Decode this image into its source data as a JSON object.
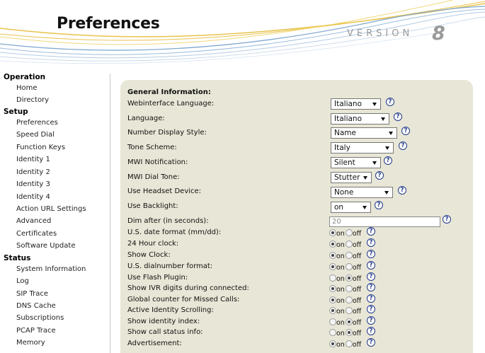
{
  "header": {
    "title": "Preferences",
    "version_word": "VERSION",
    "version_number": "8"
  },
  "sidebar": {
    "sections": [
      {
        "title": "Operation",
        "items": [
          "Home",
          "Directory"
        ]
      },
      {
        "title": "Setup",
        "items": [
          "Preferences",
          "Speed Dial",
          "Function Keys",
          "Identity 1",
          "Identity 2",
          "Identity 3",
          "Identity 4",
          "Action URL Settings",
          "Advanced",
          "Certificates",
          "Software Update"
        ]
      },
      {
        "title": "Status",
        "items": [
          "System Information",
          "Log",
          "SIP Trace",
          "DNS Cache",
          "Subscriptions",
          "PCAP Trace",
          "Memory"
        ]
      }
    ]
  },
  "form": {
    "section_title": "General Information:",
    "selects": [
      {
        "label": "Webinterface Language:",
        "value": "Italiano"
      },
      {
        "label": "Language:",
        "value": "Italiano"
      },
      {
        "label": "Number Display Style:",
        "value": "Name"
      },
      {
        "label": "Tone Scheme:",
        "value": "Italy"
      },
      {
        "label": "MWI Notification:",
        "value": "Silent"
      },
      {
        "label": "MWI Dial Tone:",
        "value": "Stutter"
      },
      {
        "label": "Use Headset Device:",
        "value": "None"
      },
      {
        "label": "Use Backlight:",
        "value": "on"
      }
    ],
    "dim": {
      "label": "Dim after (in seconds):",
      "value": "20"
    },
    "radio_on_label": "on",
    "radio_off_label": "off",
    "help_glyph": "?",
    "radios": [
      {
        "label": "U.S. date format (mm/dd):",
        "value": "on"
      },
      {
        "label": "24 Hour clock:",
        "value": "on"
      },
      {
        "label": "Show Clock:",
        "value": "on"
      },
      {
        "label": "U.S. dialnumber format:",
        "value": "on"
      },
      {
        "label": "Use Flash Plugin:",
        "value": "off"
      },
      {
        "label": "Show IVR digits during connected:",
        "value": "on"
      },
      {
        "label": "Global counter for Missed Calls:",
        "value": "on"
      },
      {
        "label": "Active Identity Scrolling:",
        "value": "on"
      },
      {
        "label": "Show identity index:",
        "value": "off"
      },
      {
        "label": "Show call status info:",
        "value": "off"
      },
      {
        "label": "Advertisement:",
        "value": "on"
      }
    ]
  },
  "colors": {
    "panel_background": "#e8e6d6",
    "help_icon": "#223a8a",
    "swoosh_blue": "#7fa8d0",
    "swoosh_gold": "#e8c34a"
  },
  "icons": {
    "help": "help-icon",
    "select_caret": "chevron-down-icon"
  }
}
